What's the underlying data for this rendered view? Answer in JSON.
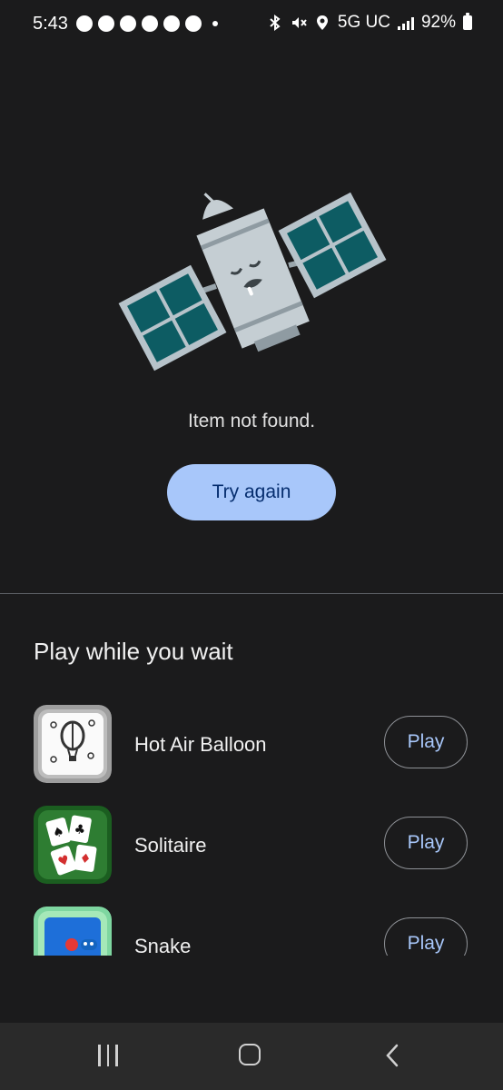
{
  "status_bar": {
    "time": "5:43",
    "network": "5G UC",
    "battery": "92%"
  },
  "error": {
    "message": "Item not found.",
    "retry_label": "Try again"
  },
  "games_section": {
    "title": "Play while you wait",
    "games": [
      {
        "name": "Hot Air Balloon",
        "play_label": "Play"
      },
      {
        "name": "Solitaire",
        "play_label": "Play"
      },
      {
        "name": "Snake",
        "play_label": "Play"
      }
    ]
  },
  "colors": {
    "background": "#1b1b1c",
    "accent": "#a8c7fa",
    "accent_text": "#062e6f",
    "satellite_panel": "#0d5c63"
  }
}
